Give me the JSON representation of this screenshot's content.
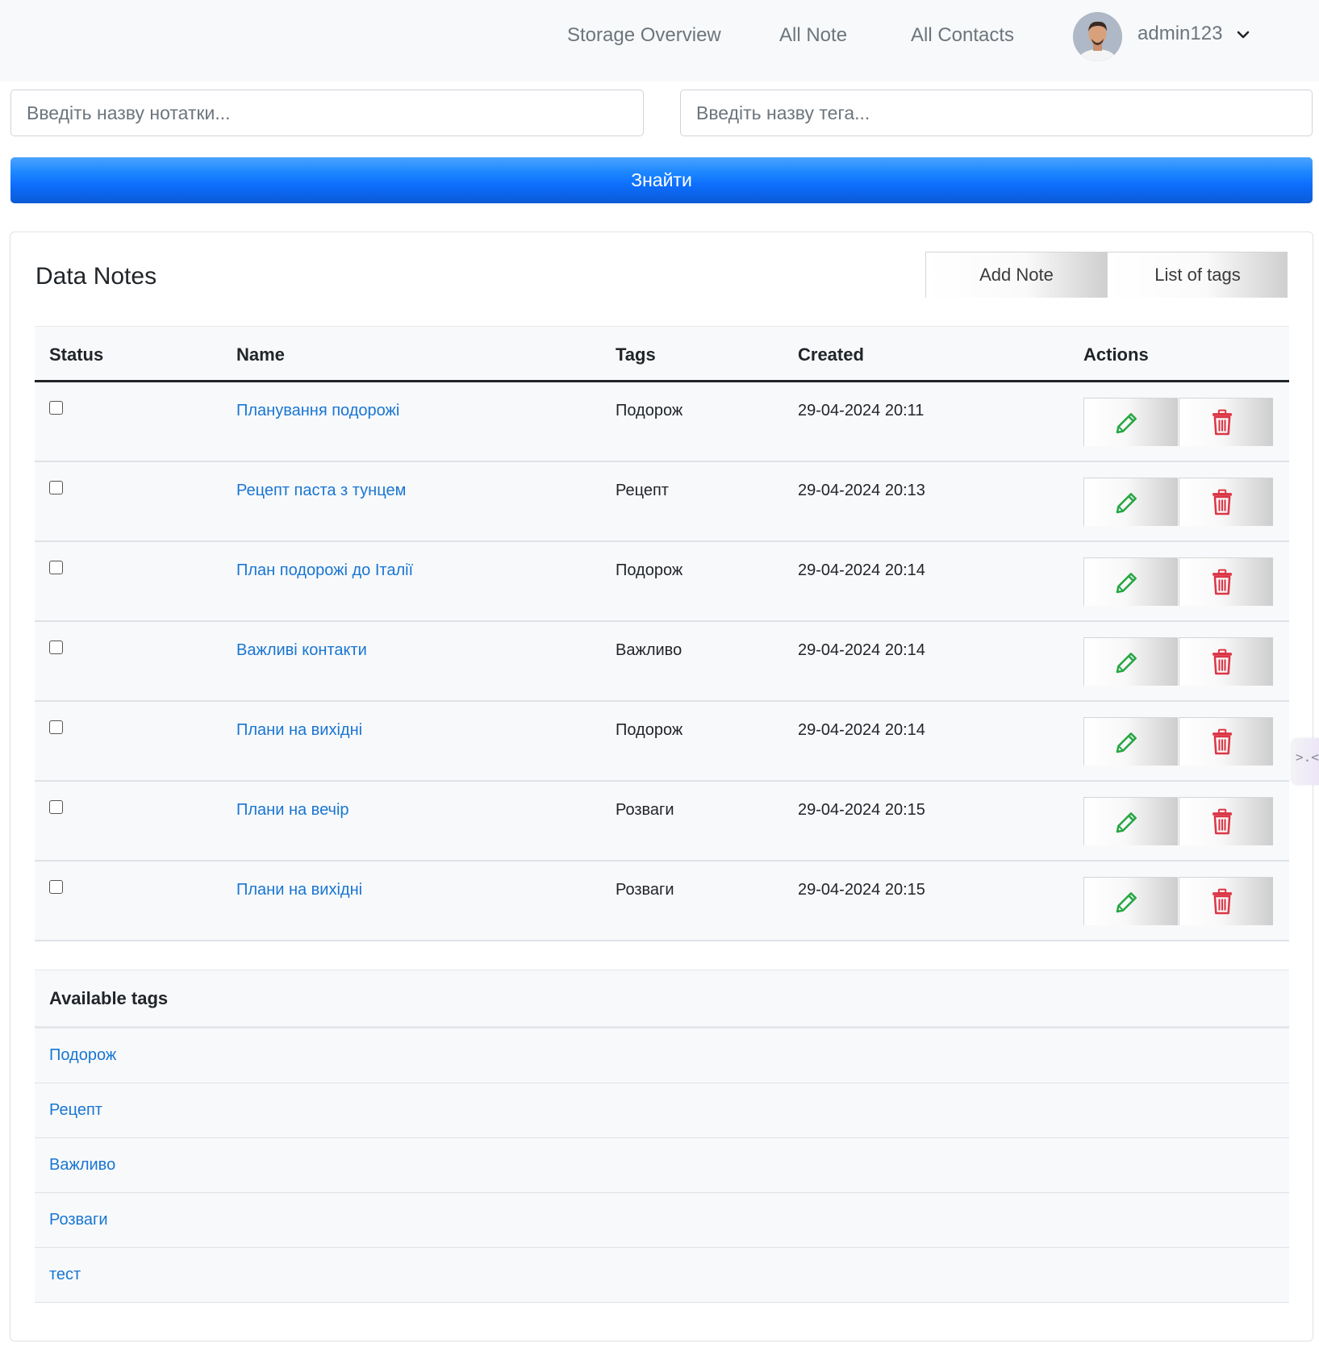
{
  "nav": {
    "links": [
      "Storage Overview",
      "All Note",
      "All Contacts"
    ],
    "username": "admin123"
  },
  "search": {
    "note_placeholder": "Введіть назву нотатки...",
    "tag_placeholder": "Введіть назву тега...",
    "button_label": "Знайти"
  },
  "notes": {
    "title": "Data Notes",
    "add_button": "Add Note",
    "tags_button": "List of tags",
    "columns": [
      "Status",
      "Name",
      "Tags",
      "Created",
      "Actions"
    ],
    "rows": [
      {
        "checked": false,
        "name": "Планування подорожі",
        "tag": "Подорож",
        "created": "29-04-2024 20:11"
      },
      {
        "checked": false,
        "name": "Рецепт паста з тунцем",
        "tag": "Рецепт",
        "created": "29-04-2024 20:13"
      },
      {
        "checked": false,
        "name": "План подорожі до Італії",
        "tag": "Подорож",
        "created": "29-04-2024 20:14"
      },
      {
        "checked": false,
        "name": "Важливі контакти",
        "tag": "Важливо",
        "created": "29-04-2024 20:14"
      },
      {
        "checked": false,
        "name": "Плани на вихідні",
        "tag": "Подорож",
        "created": "29-04-2024 20:14"
      },
      {
        "checked": false,
        "name": "Плани на вечір",
        "tag": "Розваги",
        "created": "29-04-2024 20:15"
      },
      {
        "checked": false,
        "name": "Плани на вихідні",
        "tag": "Розваги",
        "created": "29-04-2024 20:15"
      }
    ],
    "edit_icon_color": "#28a745",
    "delete_icon_color": "#dc3545"
  },
  "tags": {
    "title": "Available tags",
    "items": [
      "Подорож",
      "Рецепт",
      "Важливо",
      "Розваги",
      "тест"
    ]
  },
  "colors": {
    "primary": "#0d6efd",
    "link": "#1976d2"
  }
}
